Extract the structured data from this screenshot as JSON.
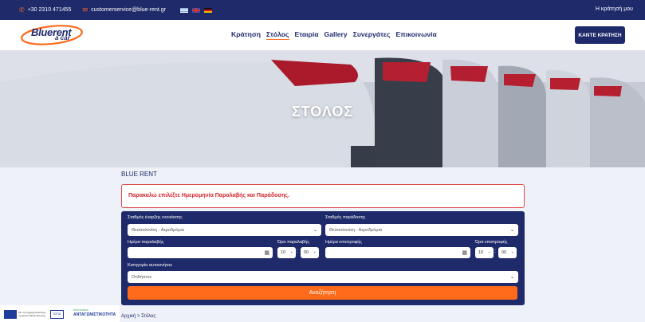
{
  "topbar": {
    "phone": "+30 2310 471455",
    "email": "customerservice@blue-rent.gr",
    "languages": [
      "greek-flag",
      "uk-flag",
      "german-flag"
    ],
    "account_label": "Η κράτησή μου"
  },
  "header": {
    "logo_line1": "Bluerent",
    "logo_line2": "a car",
    "nav": [
      "Κράτηση",
      "Στόλος",
      "Εταιρία",
      "Gallery",
      "Συνεργάτες",
      "Επικοινωνία"
    ],
    "active_nav": "Στόλος",
    "book_button": "ΚΑΝΤΕ ΚΡΑΤΗΣΗ"
  },
  "hero": {
    "title": "ΣΤΟΛΟΣ"
  },
  "main": {
    "section_label": "BLUE RENT",
    "alert": "Παρακαλώ επιλέξτε Ημερομηνία Παραλαβής και Παράδοσης."
  },
  "form": {
    "pickup_station_label": "Σταθμός έναρξης ενοικίασης",
    "pickup_station_value": "Θεσσαλονίκη - Αεροδρόμια",
    "dropoff_station_label": "Σταθμός παράδοσης",
    "dropoff_station_value": "Θεσσαλονίκη - Αεροδρόμια",
    "pickup_date_label": "Ημέρα παραλαβής",
    "pickup_date_value": "",
    "pickup_time_label": "Ώρα παραλαβής",
    "pickup_hour": "10",
    "pickup_minute": "00",
    "dropoff_date_label": "Ημέρα επιστροφής",
    "dropoff_date_value": "",
    "dropoff_time_label": "Ώρα επιστροφής",
    "dropoff_hour": "10",
    "dropoff_minute": "00",
    "category_label": "Κατηγορία αυτοκινήτου",
    "category_value": "Οτιδήποτε",
    "search_button": "Αναζήτηση"
  },
  "footer": {
    "breadcrumb": "Αρχική > Στόλος",
    "eu_text": "Με τη συγχρηματοδότηση της Ευρωπαϊκής Ένωσης",
    "espa_label": "ΕΣΠΑ",
    "anta_small": "ΠΡΟΓΡΑΜΜΑ",
    "anta_label": "ΑΝΤΑΓΩΝΙΣΤΙΚΟΤΗΤΑ"
  },
  "colors": {
    "navy": "#1f2a6b",
    "accent_orange": "#ff6b1a",
    "alert_red": "#d2232a",
    "page_bg": "#eef1f7"
  }
}
